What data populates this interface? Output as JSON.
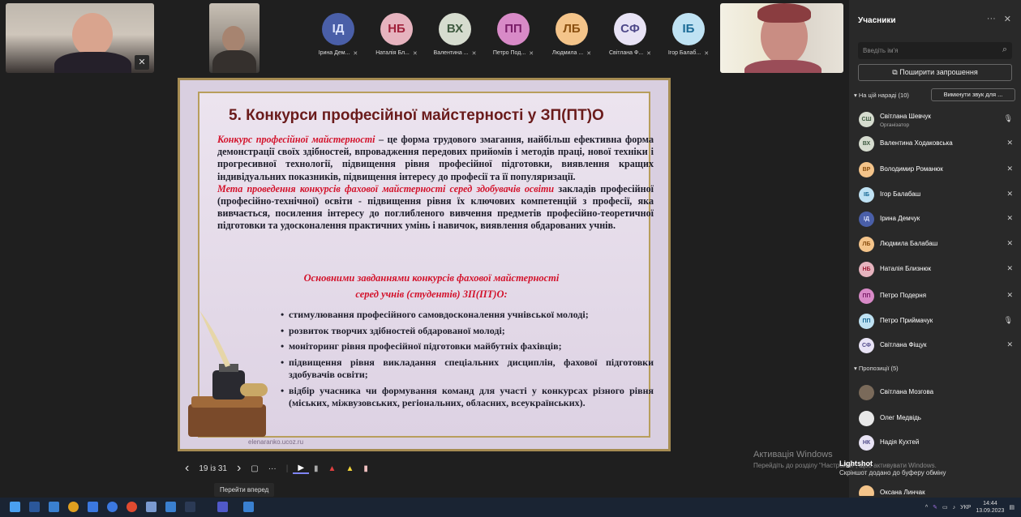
{
  "meeting": {
    "participants_strip": [
      {
        "initials": "ІД",
        "name": "Ірина Дем...",
        "color": "#4a5fa8",
        "text_color": "#dfe6ff"
      },
      {
        "initials": "НБ",
        "name": "Наталія Бл...",
        "color": "#e6b3be",
        "text_color": "#a0203a"
      },
      {
        "initials": "ВХ",
        "name": "Валентина ...",
        "color": "#d6dccf",
        "text_color": "#3f5a40"
      },
      {
        "initials": "ПП",
        "name": "Петро Под...",
        "color": "#d88ac7",
        "text_color": "#7a1d68"
      },
      {
        "initials": "ЛБ",
        "name": "Людмила ...",
        "color": "#f4c48a",
        "text_color": "#8a4f10"
      },
      {
        "initials": "СФ",
        "name": "Світлана Ф...",
        "color": "#e8e3f5",
        "text_color": "#504a8a"
      },
      {
        "initials": "ІБ",
        "name": "Ігор Балаб...",
        "color": "#bfe2f3",
        "text_color": "#1a6a96"
      }
    ]
  },
  "slide": {
    "title": "5. Конкурси професійної майстерності у ЗП(ПТ)О",
    "para1_red": "Конкурс професійної майстерності",
    "para1_rest": " – це форма трудового змагання, найбільш ефективна форма демонстрації своїх здібностей, впровадження передових прийомів і методів праці, нової техніки і прогресивної технології, підвищення рівня професійної підготовки, виявлення кращих індивідуальних показників, підвищення інтересу до професії та її популяризації.",
    "para2_red": "Мета проведення конкурсів фахової майстерності серед здобувачів освіти",
    "para2_rest": " закладів професійної (професійно-технічної) освіти - підвищення рівня їх ключових компетенцій з професії, яка вивчається, посилення інтересу до поглибленого вивчення предметів професійно-теоретичної підготовки та удосконалення практичних умінь і навичок, виявлення обдарованих учнів.",
    "subtitle1": "Основними завданнями конкурсів фахової майстерності",
    "subtitle2": "серед учнів (студентів) ЗП(ПТ)О:",
    "tasks": [
      "стимулювання професійного самовдосконалення учнівської молоді;",
      "розвиток творчих здібностей обдарованої молоді;",
      "моніторинг рівня професійної підготовки майбутніх фахівців;",
      "підвищення рівня викладання спеціальних дисциплін, фахової підготовки здобувачів освіти;",
      "відбір учасника чи формування команд для участі у конкурсах різного рівня (міських, міжвузовських, регіональних, обласних, всеукраїнських)."
    ],
    "footer": "elenaranko.ucoz.ru"
  },
  "controls": {
    "prev": "‹",
    "page": "19 із 31",
    "next": "›",
    "more": "···",
    "tooltip": "Перейти вперед"
  },
  "panel": {
    "title": "Учасники",
    "more": "···",
    "close": "✕",
    "search_placeholder": "Введіть ім'я",
    "share_button": "Поширити запрошення",
    "in_meeting_header": "На цій нараді (10)",
    "mute_all": "Вимкнути звук для ...",
    "in_meeting": [
      {
        "initials": "СШ",
        "name": "Світлана Шевчук",
        "role": "Організатор",
        "color": "#d6dccf",
        "text_color": "#3f5a40",
        "mic": "on"
      },
      {
        "initials": "ВХ",
        "name": "Валентина Ходаковська",
        "role": "",
        "color": "#d6dccf",
        "text_color": "#3f5a40",
        "mic": "off"
      },
      {
        "initials": "ВР",
        "name": "Володимир Романюк",
        "role": "",
        "color": "#f4c48a",
        "text_color": "#8a4f10",
        "mic": "off"
      },
      {
        "initials": "ІБ",
        "name": "Ігор Балабаш",
        "role": "",
        "color": "#bfe2f3",
        "text_color": "#1a6a96",
        "mic": "off"
      },
      {
        "initials": "ІД",
        "name": "Ірина Демчук",
        "role": "",
        "color": "#4a5fa8",
        "text_color": "#dfe6ff",
        "mic": "off"
      },
      {
        "initials": "ЛБ",
        "name": "Людмила Балабаш",
        "role": "",
        "color": "#f4c48a",
        "text_color": "#8a4f10",
        "mic": "off"
      },
      {
        "initials": "НБ",
        "name": "Наталія Близнюк",
        "role": "",
        "color": "#e6b3be",
        "text_color": "#a0203a",
        "mic": "off"
      },
      {
        "initials": "ПП",
        "name": "Петро Подерня",
        "role": "",
        "color": "#d88ac7",
        "text_color": "#7a1d68",
        "mic": "off"
      },
      {
        "initials": "ПП",
        "name": "Петро Приймачук",
        "role": "",
        "color": "#bfe2f3",
        "text_color": "#1a6a96",
        "mic": "on"
      },
      {
        "initials": "СФ",
        "name": "Світлана Фіщук",
        "role": "",
        "color": "#e8e3f5",
        "text_color": "#504a8a",
        "mic": "off"
      }
    ],
    "suggested_header": "Пропозиції (5)",
    "suggested": [
      {
        "initials": "СМ",
        "name": "Світлана Мозгова",
        "color": "#7a6a5a",
        "text_color": "#fff"
      },
      {
        "initials": "ОМ",
        "name": "Олег Медвідь",
        "color": "#e8e8e8",
        "text_color": "#333"
      },
      {
        "initials": "НК",
        "name": "Надія Кухтей",
        "color": "#e8e3f5",
        "text_color": "#504a8a"
      },
      {
        "initials": "ОЛ",
        "name": "Оксана Линчак",
        "color": "#f4c48a",
        "text_color": "#8a4f10"
      }
    ]
  },
  "windows": {
    "activate_title": "Активація Windows",
    "activate_text": "Перейдіть до розділу \"Настройки\", щоб активувати Windows.",
    "toast_title": "Lightshot",
    "toast_text": "Скріншот додано до буферу обміну",
    "lang": "УКР",
    "time": "14:44",
    "date": "13.09.2023"
  }
}
